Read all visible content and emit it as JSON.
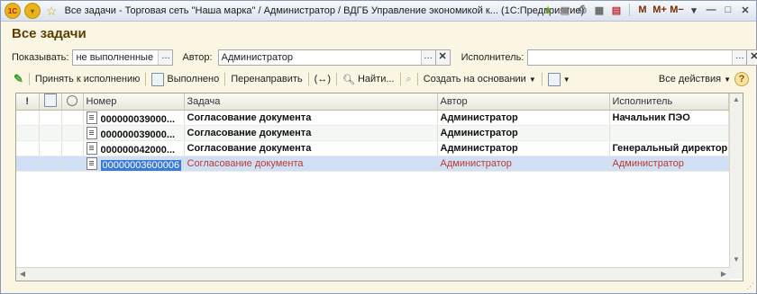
{
  "window": {
    "title": "Все задачи - Торговая сеть \"Наша марка\" / Администратор / ВДГБ Управление экономикой к... (1С:Предприятие)",
    "title_buttons": {
      "m": "M",
      "m_plus": "M+",
      "m_minus": "M−"
    }
  },
  "page": {
    "heading": "Все задачи"
  },
  "filters": {
    "show_label": "Показывать:",
    "show_value": "не выполненные",
    "author_label": "Автор:",
    "author_value": "Администратор",
    "executor_label": "Исполнитель:",
    "executor_value": ""
  },
  "toolbar": {
    "accept": "Принять к исполнению",
    "done": "Выполнено",
    "redirect": "Перенаправить",
    "links": "(↔)",
    "find": "Найти...",
    "create_based": "Создать на основании",
    "all_actions": "Все действия",
    "help": "?"
  },
  "table": {
    "headers": {
      "importance": "!",
      "done": "",
      "status": "",
      "number": "Номер",
      "task": "Задача",
      "author": "Автор",
      "executor": "Исполнитель"
    },
    "rows": [
      {
        "number": "000000039000...",
        "task": "Согласование документа",
        "author": "Администратор",
        "executor": "Начальник ПЭО",
        "style": "bold"
      },
      {
        "number": "000000039000...",
        "task": "Согласование документа",
        "author": "Администратор",
        "executor": "",
        "style": "bold"
      },
      {
        "number": "000000042000...",
        "task": "Согласование документа",
        "author": "Администратор",
        "executor": "Генеральный директор",
        "style": "bold"
      },
      {
        "number": "00000003600006",
        "task": "Согласование документа",
        "author": "Администратор",
        "executor": "Администратор",
        "style": "selected"
      }
    ]
  },
  "colors": {
    "heading": "#5a3f00",
    "selection": "#cfe0f6",
    "selected_text": "#c0392b"
  }
}
